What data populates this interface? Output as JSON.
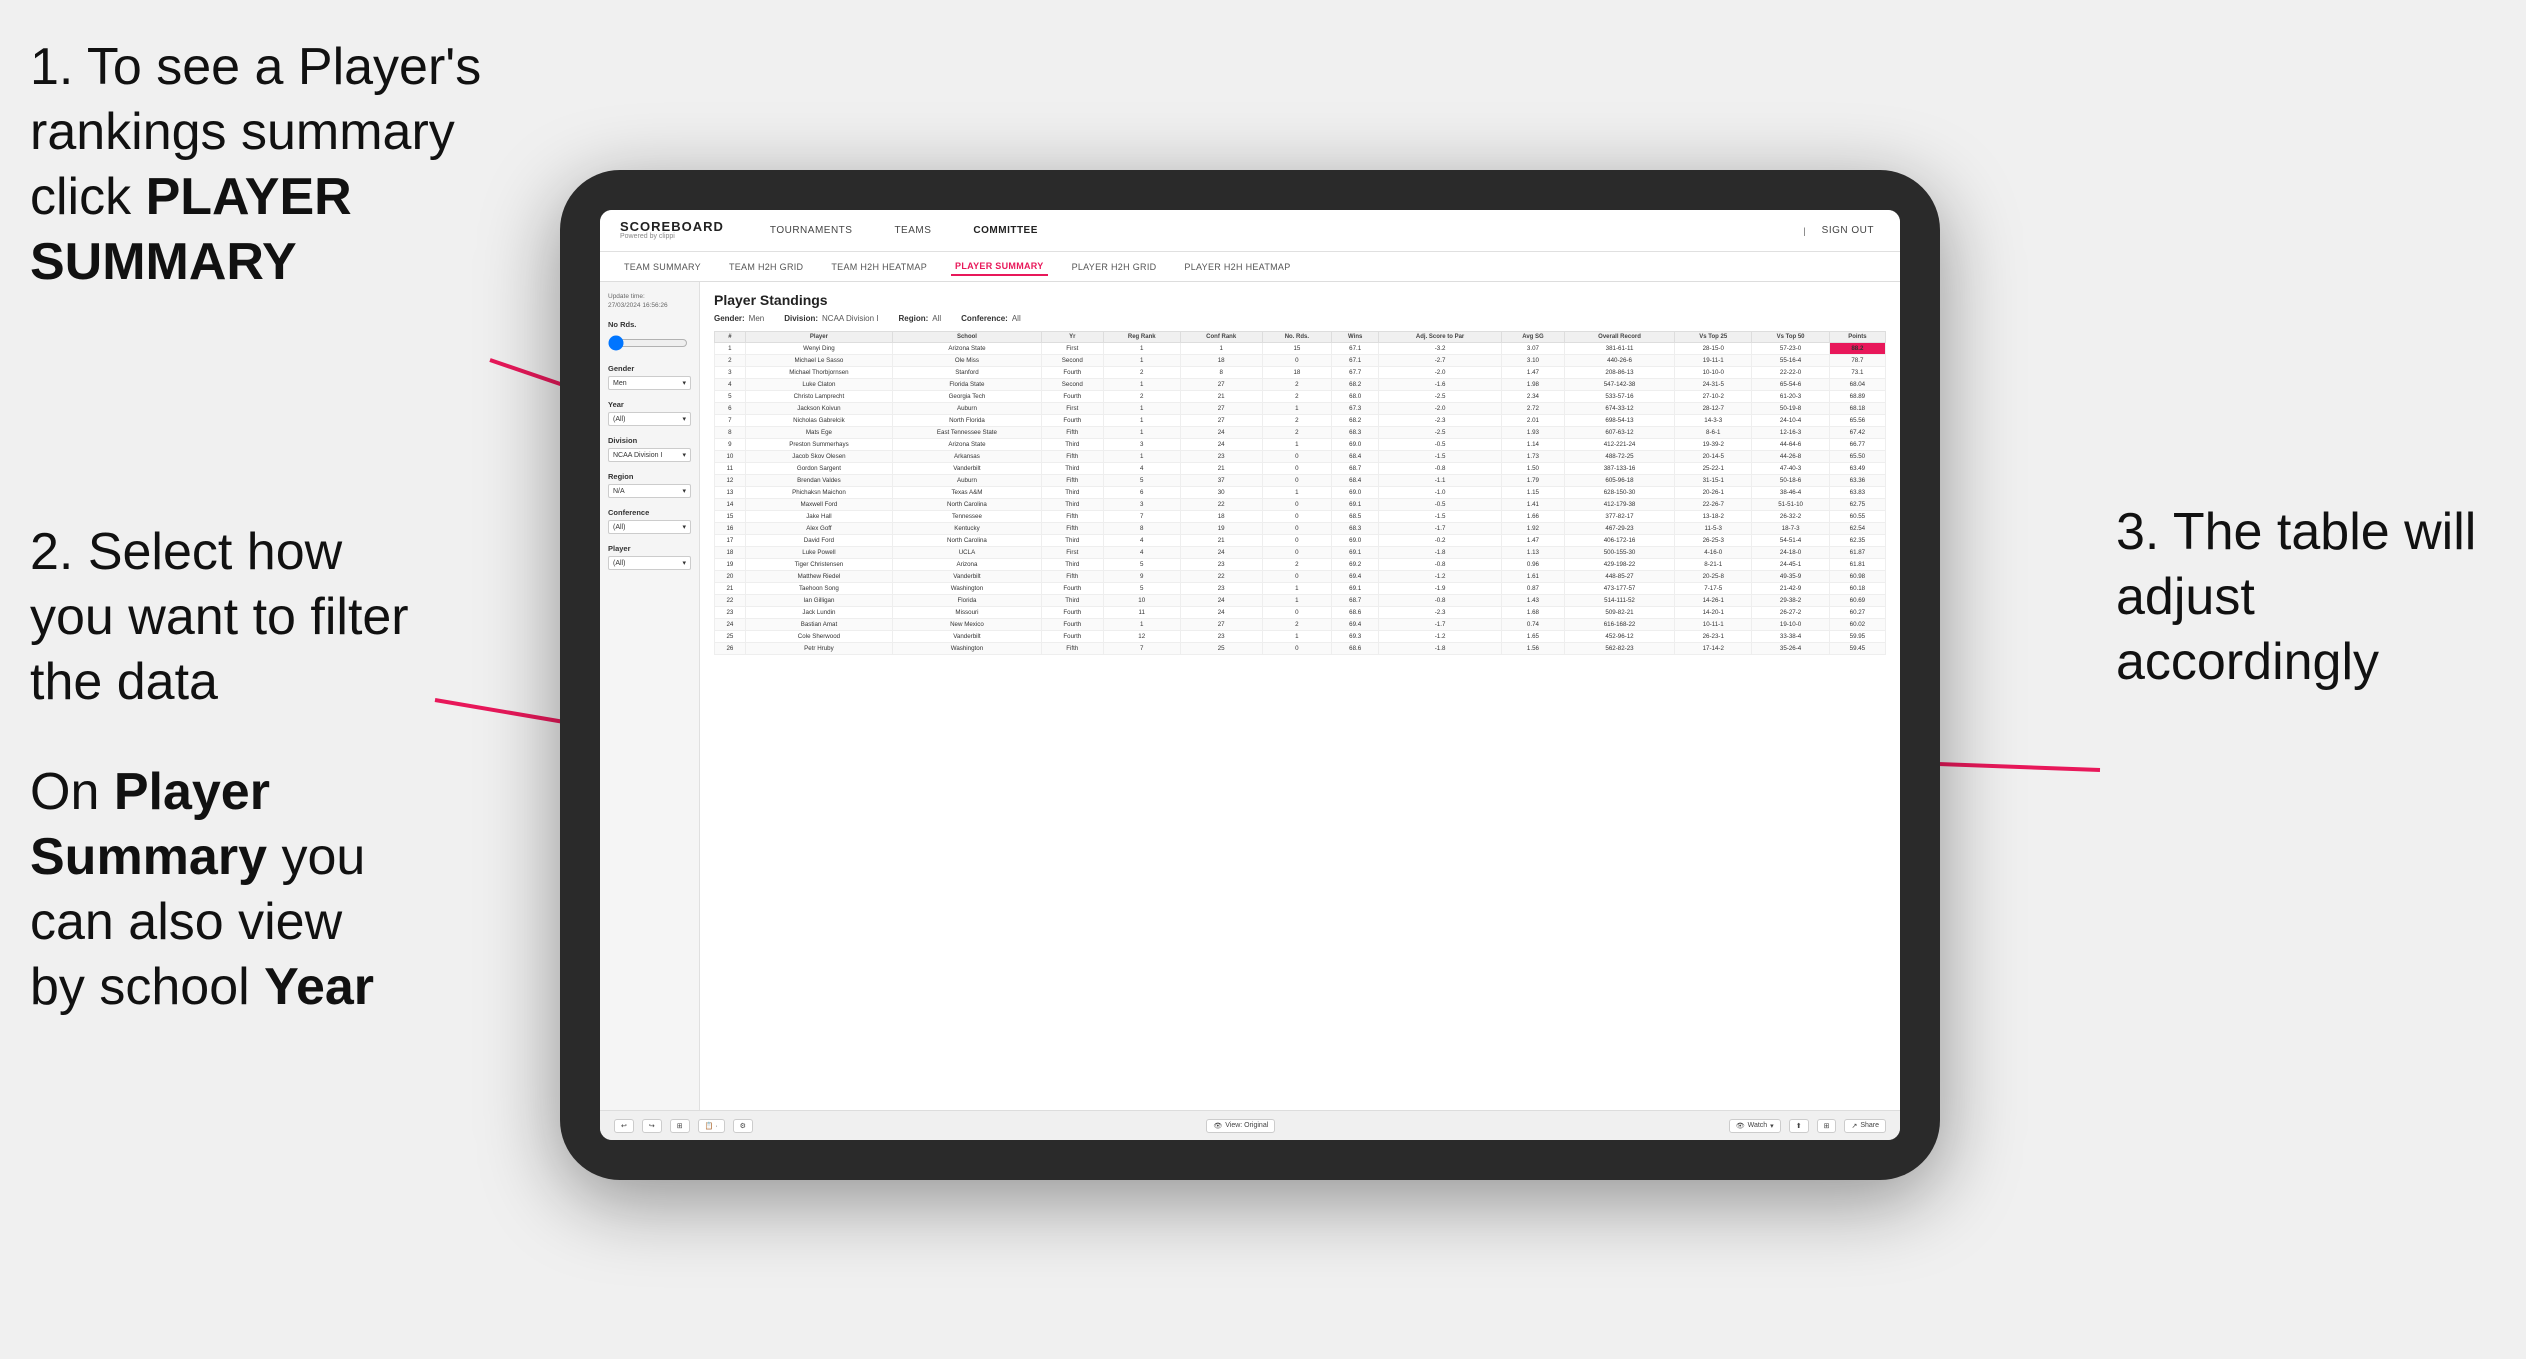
{
  "instructions": {
    "step1": "1. To see a Player's rankings summary click ",
    "step1_bold": "PLAYER SUMMARY",
    "step2": "2. Select how you want to filter the data",
    "step3_pre": "On ",
    "step3_bold1": "Player Summary",
    "step3_mid": " you can also view by school ",
    "step3_bold2": "Year",
    "step4": "3. The table will adjust accordingly"
  },
  "nav": {
    "logo": "SCOREBOARD",
    "logo_sub": "Powered by clippi",
    "items": [
      "TOURNAMENTS",
      "TEAMS",
      "COMMITTEE"
    ],
    "right_items": [
      "Sign out"
    ]
  },
  "sub_nav": {
    "items": [
      "TEAM SUMMARY",
      "TEAM H2H GRID",
      "TEAM H2H HEATMAP",
      "PLAYER SUMMARY",
      "PLAYER H2H GRID",
      "PLAYER H2H HEATMAP"
    ],
    "active": "PLAYER SUMMARY"
  },
  "sidebar": {
    "update_label": "Update time:",
    "update_date": "27/03/2024 16:56:26",
    "no_rds_label": "No Rds.",
    "gender_label": "Gender",
    "gender_value": "Men",
    "year_label": "Year",
    "year_value": "(All)",
    "division_label": "Division",
    "division_value": "NCAA Division I",
    "region_label": "Region",
    "region_value": "N/A",
    "conference_label": "Conference",
    "conference_value": "(All)",
    "player_label": "Player",
    "player_value": "(All)"
  },
  "table": {
    "title": "Player Standings",
    "filters": {
      "gender_label": "Gender:",
      "gender_value": "Men",
      "division_label": "Division:",
      "division_value": "NCAA Division I",
      "region_label": "Region:",
      "region_value": "All",
      "conference_label": "Conference:",
      "conference_value": "All"
    },
    "columns": [
      "#",
      "Player",
      "School",
      "Yr",
      "Reg Rank",
      "Conf Rank",
      "No. Rds.",
      "Wins",
      "Adj. Score to Par",
      "Avg SG",
      "Overall Record",
      "Vs Top 25",
      "Vs Top 50",
      "Points"
    ],
    "rows": [
      [
        "1",
        "Wenyi Ding",
        "Arizona State",
        "First",
        "1",
        "1",
        "15",
        "67.1",
        "-3.2",
        "3.07",
        "381-61-11",
        "28-15-0",
        "57-23-0",
        "88.2"
      ],
      [
        "2",
        "Michael Le Sasso",
        "Ole Miss",
        "Second",
        "1",
        "18",
        "0",
        "67.1",
        "-2.7",
        "3.10",
        "440-26-6",
        "19-11-1",
        "55-16-4",
        "78.7"
      ],
      [
        "3",
        "Michael Thorbjornsen",
        "Stanford",
        "Fourth",
        "2",
        "8",
        "18",
        "67.7",
        "-2.0",
        "1.47",
        "208-86-13",
        "10-10-0",
        "22-22-0",
        "73.1"
      ],
      [
        "4",
        "Luke Claton",
        "Florida State",
        "Second",
        "1",
        "27",
        "2",
        "68.2",
        "-1.6",
        "1.98",
        "547-142-38",
        "24-31-5",
        "65-54-6",
        "68.04"
      ],
      [
        "5",
        "Christo Lamprecht",
        "Georgia Tech",
        "Fourth",
        "2",
        "21",
        "2",
        "68.0",
        "-2.5",
        "2.34",
        "533-57-16",
        "27-10-2",
        "61-20-3",
        "68.89"
      ],
      [
        "6",
        "Jackson Koivun",
        "Auburn",
        "First",
        "1",
        "27",
        "1",
        "67.3",
        "-2.0",
        "2.72",
        "674-33-12",
        "28-12-7",
        "50-19-8",
        "68.18"
      ],
      [
        "7",
        "Nicholas Gabrelcik",
        "North Florida",
        "Fourth",
        "1",
        "27",
        "2",
        "68.2",
        "-2.3",
        "2.01",
        "698-54-13",
        "14-3-3",
        "24-10-4",
        "65.56"
      ],
      [
        "8",
        "Mats Ege",
        "East Tennessee State",
        "Fifth",
        "1",
        "24",
        "2",
        "68.3",
        "-2.5",
        "1.93",
        "607-63-12",
        "8-6-1",
        "12-16-3",
        "67.42"
      ],
      [
        "9",
        "Preston Summerhays",
        "Arizona State",
        "Third",
        "3",
        "24",
        "1",
        "69.0",
        "-0.5",
        "1.14",
        "412-221-24",
        "19-39-2",
        "44-64-6",
        "66.77"
      ],
      [
        "10",
        "Jacob Skov Olesen",
        "Arkansas",
        "Fifth",
        "1",
        "23",
        "0",
        "68.4",
        "-1.5",
        "1.73",
        "488-72-25",
        "20-14-5",
        "44-26-8",
        "65.50"
      ],
      [
        "11",
        "Gordon Sargent",
        "Vanderbilt",
        "Third",
        "4",
        "21",
        "0",
        "68.7",
        "-0.8",
        "1.50",
        "387-133-16",
        "25-22-1",
        "47-40-3",
        "63.49"
      ],
      [
        "12",
        "Brendan Valdes",
        "Auburn",
        "Fifth",
        "5",
        "37",
        "0",
        "68.4",
        "-1.1",
        "1.79",
        "605-96-18",
        "31-15-1",
        "50-18-6",
        "63.36"
      ],
      [
        "13",
        "Phichaksn Maichon",
        "Texas A&M",
        "Third",
        "6",
        "30",
        "1",
        "69.0",
        "-1.0",
        "1.15",
        "628-150-30",
        "20-26-1",
        "38-46-4",
        "63.83"
      ],
      [
        "14",
        "Maxwell Ford",
        "North Carolina",
        "Third",
        "3",
        "22",
        "0",
        "69.1",
        "-0.5",
        "1.41",
        "412-179-38",
        "22-26-7",
        "51-51-10",
        "62.75"
      ],
      [
        "15",
        "Jake Hall",
        "Tennessee",
        "Fifth",
        "7",
        "18",
        "0",
        "68.5",
        "-1.5",
        "1.66",
        "377-82-17",
        "13-18-2",
        "26-32-2",
        "60.55"
      ],
      [
        "16",
        "Alex Goff",
        "Kentucky",
        "Fifth",
        "8",
        "19",
        "0",
        "68.3",
        "-1.7",
        "1.92",
        "467-29-23",
        "11-5-3",
        "18-7-3",
        "62.54"
      ],
      [
        "17",
        "David Ford",
        "North Carolina",
        "Third",
        "4",
        "21",
        "0",
        "69.0",
        "-0.2",
        "1.47",
        "406-172-16",
        "26-25-3",
        "54-51-4",
        "62.35"
      ],
      [
        "18",
        "Luke Powell",
        "UCLA",
        "First",
        "4",
        "24",
        "0",
        "69.1",
        "-1.8",
        "1.13",
        "500-155-30",
        "4-16-0",
        "24-18-0",
        "61.87"
      ],
      [
        "19",
        "Tiger Christensen",
        "Arizona",
        "Third",
        "5",
        "23",
        "2",
        "69.2",
        "-0.8",
        "0.96",
        "429-198-22",
        "8-21-1",
        "24-45-1",
        "61.81"
      ],
      [
        "20",
        "Matthew Riedel",
        "Vanderbilt",
        "Fifth",
        "9",
        "22",
        "0",
        "69.4",
        "-1.2",
        "1.61",
        "448-85-27",
        "20-25-8",
        "49-35-9",
        "60.98"
      ],
      [
        "21",
        "Taehoon Song",
        "Washington",
        "Fourth",
        "5",
        "23",
        "1",
        "69.1",
        "-1.9",
        "0.87",
        "473-177-57",
        "7-17-5",
        "21-42-9",
        "60.18"
      ],
      [
        "22",
        "Ian Gilligan",
        "Florida",
        "Third",
        "10",
        "24",
        "1",
        "68.7",
        "-0.8",
        "1.43",
        "514-111-52",
        "14-26-1",
        "29-38-2",
        "60.69"
      ],
      [
        "23",
        "Jack Lundin",
        "Missouri",
        "Fourth",
        "11",
        "24",
        "0",
        "68.6",
        "-2.3",
        "1.68",
        "509-82-21",
        "14-20-1",
        "26-27-2",
        "60.27"
      ],
      [
        "24",
        "Bastian Amat",
        "New Mexico",
        "Fourth",
        "1",
        "27",
        "2",
        "69.4",
        "-1.7",
        "0.74",
        "616-168-22",
        "10-11-1",
        "19-10-0",
        "60.02"
      ],
      [
        "25",
        "Cole Sherwood",
        "Vanderbilt",
        "Fourth",
        "12",
        "23",
        "1",
        "69.3",
        "-1.2",
        "1.65",
        "452-96-12",
        "26-23-1",
        "33-38-4",
        "59.95"
      ],
      [
        "26",
        "Petr Hruby",
        "Washington",
        "Fifth",
        "7",
        "25",
        "0",
        "68.6",
        "-1.8",
        "1.56",
        "562-82-23",
        "17-14-2",
        "35-26-4",
        "59.45"
      ]
    ]
  },
  "toolbar": {
    "view_label": "View: Original",
    "watch_label": "Watch",
    "share_label": "Share"
  }
}
